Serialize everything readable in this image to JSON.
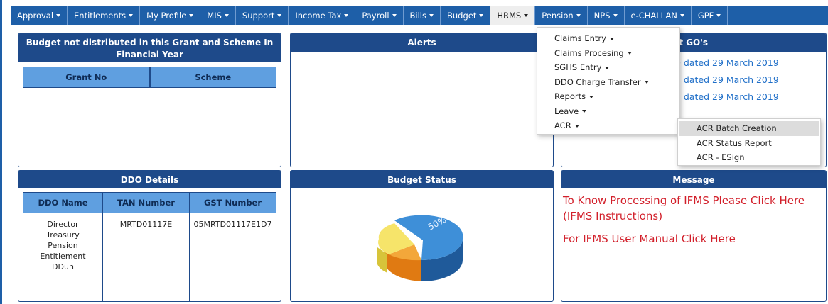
{
  "nav": {
    "items": [
      "Approval",
      "Entitlements",
      "My Profile",
      "MIS",
      "Support",
      "Income Tax",
      "Payroll",
      "Bills",
      "Budget",
      "HRMS",
      "Pension",
      "NPS",
      "e-CHALLAN",
      "GPF"
    ]
  },
  "hrms_menu": {
    "items": [
      "Claims Entry",
      "Claims Procesing",
      "SGHS Entry",
      "DDO Charge Transfer",
      "Reports",
      "Leave",
      "ACR"
    ]
  },
  "acr_menu": {
    "items": [
      "ACR Batch Creation",
      "ACR Status Report",
      "ACR - ESign"
    ]
  },
  "budget_panel": {
    "title": "Budget not distributed in this Grant and Scheme In Financial Year",
    "col_grant": "Grant No",
    "col_scheme": "Scheme"
  },
  "alerts_panel": {
    "title": "Alerts"
  },
  "go_panel": {
    "title": "est GO's",
    "lines": [
      "0 dated 29 March 2019",
      "1 dated 29 March 2019",
      "2 dated 29 March 2019"
    ]
  },
  "ddo_panel": {
    "title": "DDO Details",
    "headers": [
      "DDO Name",
      "TAN Number",
      "GST Number"
    ],
    "row": [
      "Director Treasury Pension Entitlement DDun",
      "MRTD01117E",
      "05MRTD01117E1D7"
    ]
  },
  "budget_status_panel": {
    "title": "Budget Status",
    "pie_label": "50%"
  },
  "message_panel": {
    "title": "Message",
    "link1": "To Know Processing of IFMS Please Click Here (IFMS Instructions)",
    "link2": "For IFMS User Manual Click Here"
  }
}
